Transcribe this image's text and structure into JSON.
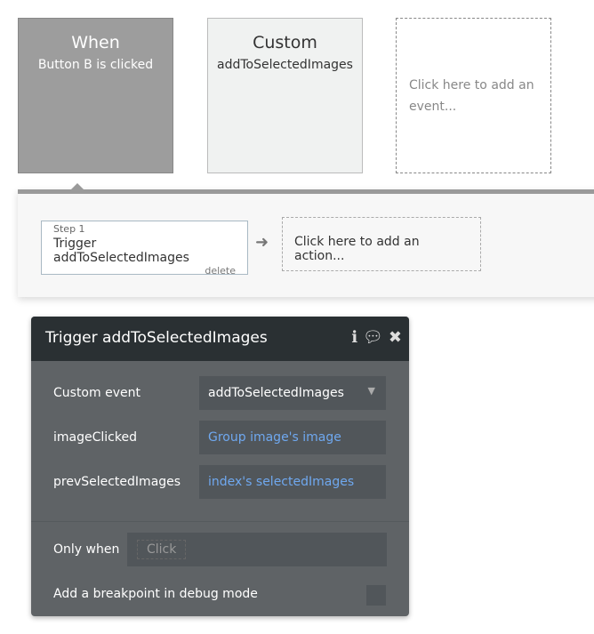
{
  "events": [
    {
      "title": "When",
      "subtitle": "Button B is clicked"
    },
    {
      "title": "Custom",
      "subtitle": "addToSelectedImages"
    }
  ],
  "add_event": "Click here to add an event...",
  "step": {
    "label": "Step 1",
    "title": "Trigger addToSelectedImages",
    "delete": "delete"
  },
  "add_action": "Click here to add an action...",
  "panel": {
    "title": "Trigger addToSelectedImages",
    "custom_event_label": "Custom event",
    "custom_event_value": "addToSelectedImages",
    "params": [
      {
        "label": "imageClicked",
        "value": "Group image's image"
      },
      {
        "label": "prevSelectedImages",
        "value": "index's selectedImages"
      }
    ],
    "only_when_label": "Only when",
    "only_when_placeholder": "Click",
    "breakpoint_label": "Add a breakpoint in debug mode"
  }
}
